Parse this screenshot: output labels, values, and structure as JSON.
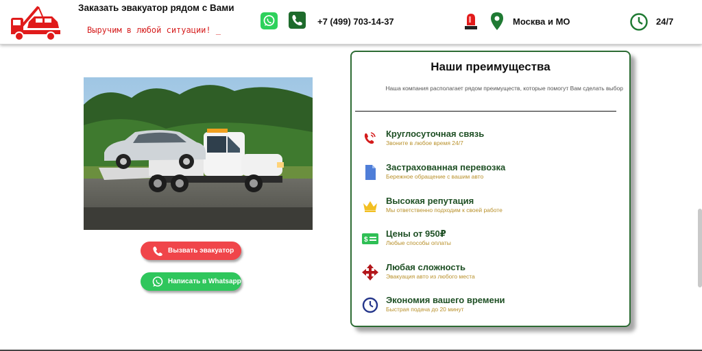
{
  "header": {
    "title": "Заказать эвакуатор рядом с Вами",
    "slogan": "Выручим в любой ситуации!",
    "cursor": "_",
    "phone": "+7 (499) 703-14-37",
    "region": "Москва и МО",
    "hours": "24/7",
    "icons": [
      "tow-truck-logo",
      "whatsapp-icon",
      "phone-icon",
      "siren-icon",
      "location-pin-icon",
      "clock-icon"
    ]
  },
  "buttons": {
    "call_label": "Вызвать эвакуатор",
    "whatsapp_label": "Написать в Whatsapp"
  },
  "advantages": {
    "title": "Наши преимущества",
    "subtitle": "Наша компания располагает рядом преимуществ, которые помогут Вам сделать выбор",
    "items": [
      {
        "title": "Круглосуточная связь",
        "subtitle": "Звоните в любое время 24/7",
        "icon": "phone-ringing-icon"
      },
      {
        "title": "Застрахованная перевозка",
        "subtitle": "Бережное обращение с вашим авто",
        "icon": "document-icon"
      },
      {
        "title": "Высокая репутация",
        "subtitle": "Мы ответственно подходим к своей работе",
        "icon": "crown-icon"
      },
      {
        "title": "Цены от 950₽",
        "subtitle": "Любые способы оплаты",
        "icon": "money-icon"
      },
      {
        "title": "Любая сложность",
        "subtitle": "Эвакуация авто из любого места",
        "icon": "arrows-move-icon"
      },
      {
        "title": "Экономия вашего времени",
        "subtitle": "Быстрая подача до 20 минут",
        "icon": "clock-icon"
      }
    ]
  },
  "colors": {
    "accent_red": "#f0454a",
    "accent_green": "#2fc65c",
    "title_green": "#1e4f24",
    "subtitle_gold": "#b8902a",
    "card_border": "#2c6b33"
  }
}
